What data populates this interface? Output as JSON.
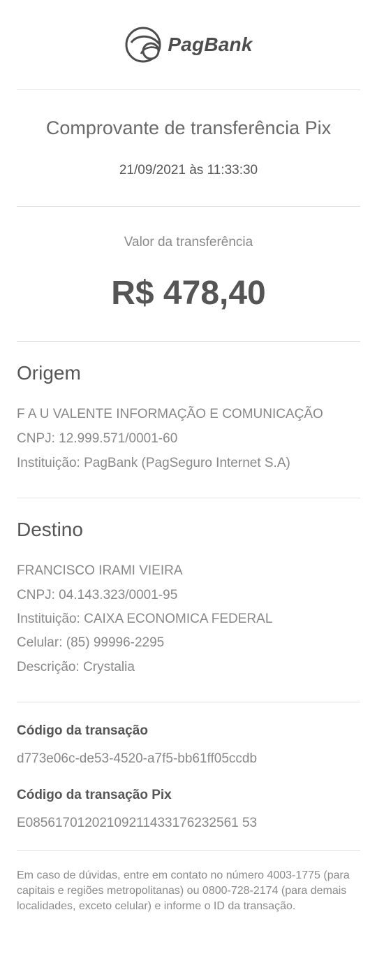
{
  "brand": {
    "name": "PagBank"
  },
  "header": {
    "title": "Comprovante de transferência Pix",
    "datetime": "21/09/2021 às 11:33:30"
  },
  "transfer": {
    "label": "Valor da transferência",
    "amount": "R$ 478,40"
  },
  "origin": {
    "heading": "Origem",
    "name": "F A U VALENTE INFORMAÇÃO E COMUNICAÇÃO",
    "cnpj": "CNPJ:  12.999.571/0001-60",
    "institution": "Instituição: PagBank (PagSeguro Internet S.A)"
  },
  "destination": {
    "heading": "Destino",
    "name": "FRANCISCO IRAMI VIEIRA",
    "cnpj": "CNPJ:  04.143.323/0001-95",
    "institution": "Instituição: CAIXA ECONOMICA FEDERAL",
    "phone": "Celular:  (85) 99996-2295",
    "description": "Descrição:  Crystalia"
  },
  "codes": {
    "transaction_label": "Código da transação",
    "transaction_value": "d773e06c-de53-4520-a7f5-bb61ff05ccdb",
    "pix_label": "Código da transação Pix",
    "pix_value": "E08561701202109211433176232561 53"
  },
  "footer": {
    "text": "Em caso de dúvidas, entre em contato no número 4003-1775 (para capitais e regiões metropolitanas) ou 0800-728-2174 (para demais localidades, exceto celular) e informe o ID da transação."
  },
  "colors": {
    "text_dark": "#555555",
    "text_light": "#888888",
    "divider": "#e2e2e2"
  }
}
